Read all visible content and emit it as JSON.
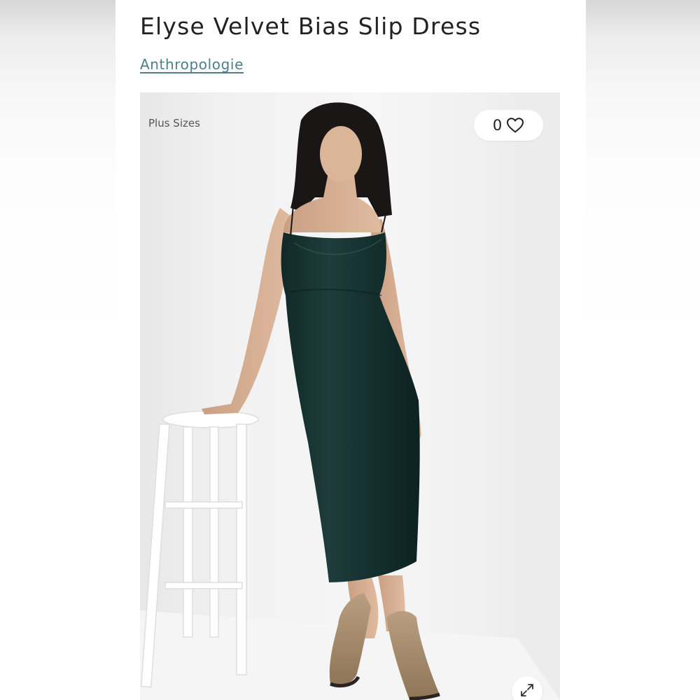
{
  "product": {
    "title": "Elyse Velvet Bias Slip Dress",
    "brand": "Anthropologie"
  },
  "image": {
    "badge_label": "Plus Sizes",
    "favorites_count": "0",
    "favorite_icon": "heart-outline-icon",
    "expand_icon": "expand-arrows-icon",
    "dress_color": "#1f3a3a"
  },
  "colors": {
    "title_text": "#222222",
    "brand_link": "#4f7f86",
    "badge_text": "#555555"
  }
}
